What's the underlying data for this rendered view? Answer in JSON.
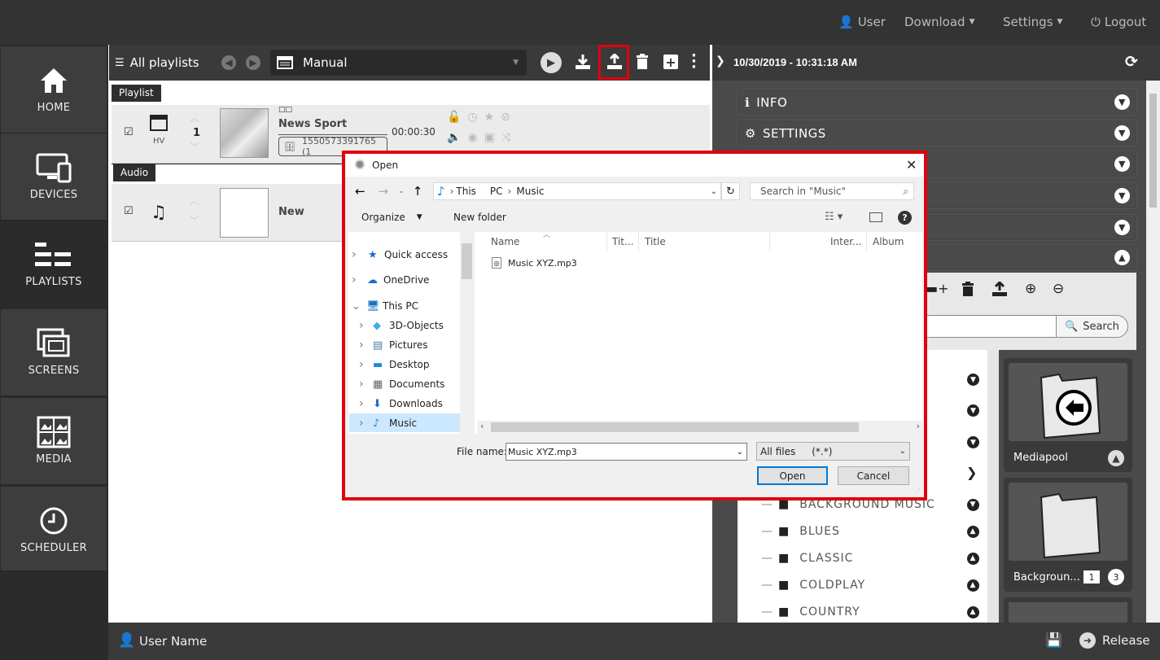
{
  "topbar": {
    "user": "User",
    "download": "Download",
    "settings": "Settings",
    "logout": "Logout"
  },
  "sidebar": {
    "items": [
      {
        "label": "HOME",
        "icon": "home-icon"
      },
      {
        "label": "DEVICES",
        "icon": "devices-icon"
      },
      {
        "label": "PLAYLISTS",
        "icon": "playlists-icon",
        "active": true
      },
      {
        "label": "SCREENS",
        "icon": "screens-icon"
      },
      {
        "label": "MEDIA",
        "icon": "media-icon"
      },
      {
        "label": "SCHEDULER",
        "icon": "clock-icon"
      }
    ]
  },
  "playlist_toolbar": {
    "all_playlists": "All playlists",
    "selected": "Manual"
  },
  "playlist_groups": {
    "playlist_tag": "Playlist",
    "audio_tag": "Audio"
  },
  "rows": [
    {
      "type_label": "HV",
      "order": "1",
      "title": "News Sport",
      "duration": "00:00:30",
      "id": "1550573391765 (1",
      "thumb_text": "□□"
    },
    {
      "title": "New"
    }
  ],
  "right_panel": {
    "datetime": "10/30/2019 - 10:31:18 AM",
    "sections": {
      "info": "INFO",
      "settings": "SETTINGS"
    },
    "search_button": "Search",
    "folders": [
      {
        "name": "Mediapool"
      },
      {
        "name": "Backgroun...",
        "badge_a": "1",
        "badge_b": "3"
      }
    ],
    "tree": [
      "BACKGROUND MUSIC",
      "BLUES",
      "CLASSIC",
      "COLDPLAY",
      "COUNTRY"
    ]
  },
  "bottom": {
    "user_name": "User Name",
    "release": "Release"
  },
  "dialog": {
    "title": "Open",
    "breadcrumb": [
      "This",
      "PC",
      "Music"
    ],
    "search_placeholder": "Search in \"Music\"",
    "organize": "Organize",
    "new_folder": "New folder",
    "nav_items": [
      {
        "label": "Quick access",
        "icon": "star-icon"
      },
      {
        "label": "OneDrive",
        "icon": "cloud-icon"
      },
      {
        "label": "This PC",
        "icon": "computer-icon",
        "expanded": true
      },
      {
        "label": "3D-Objects",
        "icon": "cube-icon"
      },
      {
        "label": "Pictures",
        "icon": "pictures-icon"
      },
      {
        "label": "Desktop",
        "icon": "desktop-icon"
      },
      {
        "label": "Documents",
        "icon": "documents-icon"
      },
      {
        "label": "Downloads",
        "icon": "download-arrow-icon"
      },
      {
        "label": "Music",
        "icon": "music-note-icon",
        "selected": true
      }
    ],
    "columns": [
      "Name",
      "Tit...",
      "Title",
      "Inter...",
      "Album"
    ],
    "files": [
      "Music XYZ.mp3"
    ],
    "file_name_label": "File name:",
    "file_name_value": "Music XYZ.mp3",
    "file_type": "All files",
    "file_type_pattern": "(*.*)",
    "open_button": "Open",
    "cancel_button": "Cancel"
  },
  "colors": {
    "highlight": "#e0000f",
    "dark": "#333333",
    "panel": "#4a4a4a"
  }
}
